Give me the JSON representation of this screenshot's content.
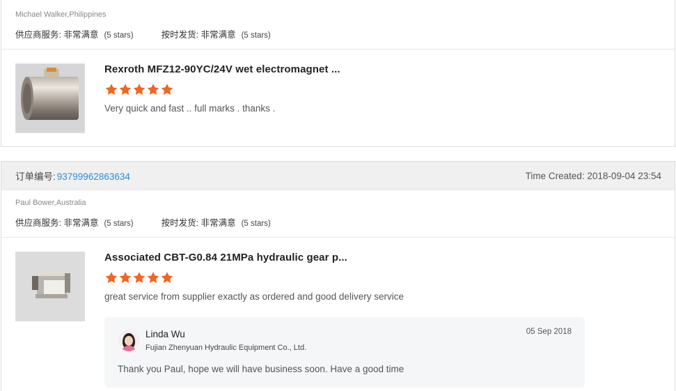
{
  "reviews": [
    {
      "buyer": "Michael Walker,Philippines",
      "ratings": [
        {
          "label": "供应商服务: 非常满意",
          "note": "(5 stars)"
        },
        {
          "label": "按时发货: 非常满意",
          "note": "(5 stars)"
        }
      ],
      "product": {
        "title": "Rexroth MFZ12-90YC/24V wet electromagnet ...",
        "stars": 5,
        "comment": "Very quick and fast .. full marks . thanks ."
      }
    },
    {
      "order_label": "订单编号:",
      "order_number": "93799962863634",
      "time_created": "Time Created: 2018-09-04 23:54",
      "buyer": "Paul Bower,Australia",
      "ratings": [
        {
          "label": "供应商服务: 非常满意",
          "note": "(5 stars)"
        },
        {
          "label": "按时发货: 非常满意",
          "note": "(5 stars)"
        }
      ],
      "product": {
        "title": "Associated CBT-G0.84 21MPa hydraulic gear p...",
        "stars": 5,
        "comment": "great service from supplier exactly as ordered and good delivery service"
      },
      "reply": {
        "name": "Linda Wu",
        "company": "Fujian Zhenyuan Hydraulic Equipment Co., Ltd.",
        "date": "05 Sep 2018",
        "text": "Thank you Paul, hope we will have business soon. Have a good time"
      }
    }
  ],
  "colors": {
    "star": "#f26522",
    "link": "#2a8bd8",
    "header_bg": "#f0f0f0",
    "reply_bg": "#f5f6f7"
  },
  "icons": [
    "star-icon",
    "avatar"
  ]
}
